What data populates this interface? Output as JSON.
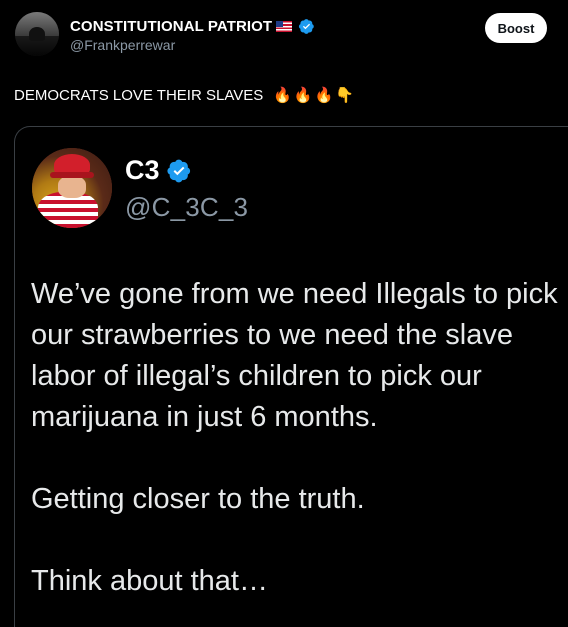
{
  "post": {
    "author": {
      "display_name": "CONSTITUTIONAL PATRIOT",
      "handle": "@Frankperrewar",
      "flag": "us-flag-icon",
      "verified": true
    },
    "boost_label": "Boost",
    "text": "DEMOCRATS LOVE THEIR SLAVES",
    "emojis": [
      "🔥",
      "🔥",
      "🔥",
      "👇"
    ]
  },
  "quoted_post": {
    "author": {
      "display_name": "C3",
      "handle": "@C_3C_3",
      "verified": true
    },
    "paragraphs": [
      "We’ve gone from we need Illegals to pick our strawberries to we need the slave labor of illegal’s children to pick our marijuana in just 6 months.",
      "Getting closer to the truth.",
      "Think about that…"
    ]
  },
  "colors": {
    "background": "#000000",
    "text_primary": "#ffffff",
    "text_secondary": "#8b98a5",
    "verified_blue": "#1d9bf0",
    "card_border": "#3a3f44"
  }
}
